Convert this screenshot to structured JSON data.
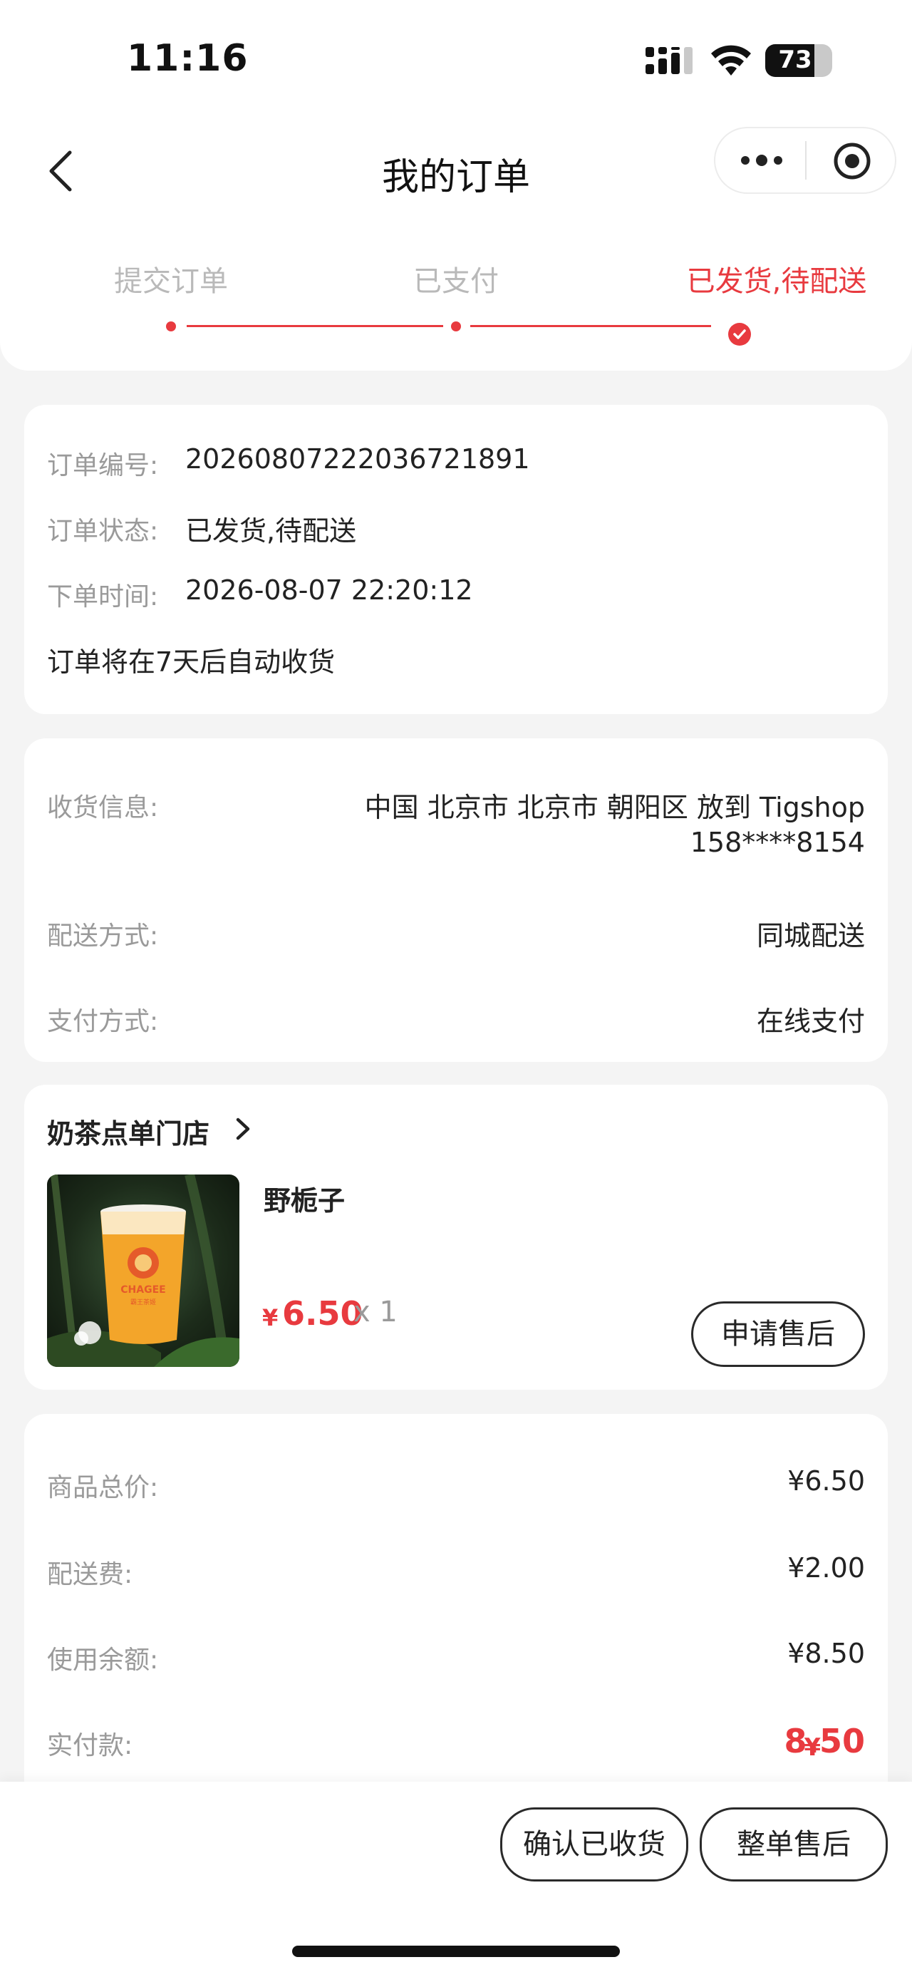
{
  "status_bar": {
    "time": "11:16",
    "battery": "73",
    "battery_level": 0.73
  },
  "header": {
    "title": "我的订单"
  },
  "steps": [
    {
      "label": "提交订单",
      "done": true
    },
    {
      "label": "已支付",
      "done": true
    },
    {
      "label": "已发货,待配送",
      "done": true,
      "current": true
    }
  ],
  "order_info": {
    "number_label": "订单编号:",
    "number": "20260807222036721891",
    "status_label": "订单状态:",
    "status": "已发货,待配送",
    "time_label": "下单时间:",
    "time": "2026-08-07 22:20:12",
    "auto_receive_note": "订单将在7天后自动收货"
  },
  "delivery": {
    "address_label": "收货信息:",
    "address": "中国 北京市 北京市 朝阳区 放到 Tigshop",
    "phone": "158****8154",
    "method_label": "配送方式:",
    "method": "同城配送",
    "payment_label": "支付方式:",
    "payment": "在线支付"
  },
  "store": {
    "name": "奶茶点单门店",
    "product": {
      "name": "野栀子",
      "currency": "¥",
      "price": "6.50",
      "qty": "x 1",
      "image_brand": "CHAGEE",
      "image_sub": "霸王茶姬"
    },
    "after_sale_button": "申请售后"
  },
  "totals": {
    "goods_label": "商品总价:",
    "goods": "¥6.50",
    "shipping_label": "配送费:",
    "shipping": "¥2.00",
    "balance_label": "使用余额:",
    "balance": "¥8.50",
    "paid_label": "实付款:",
    "paid_currency": "¥",
    "paid": "8.50"
  },
  "footer": {
    "confirm_button": "确认已收货",
    "whole_after_sale_button": "整单售后"
  },
  "colors": {
    "accent": "#e83a3f",
    "inactive_step": "#b9b9b9",
    "label_gray": "#9a9a9a",
    "page_bg": "#f4f4f4"
  },
  "icons": [
    "back-icon",
    "more-icon",
    "target-icon",
    "check-icon",
    "chevron-right-icon",
    "signal-icon",
    "wifi-icon",
    "battery-icon"
  ]
}
